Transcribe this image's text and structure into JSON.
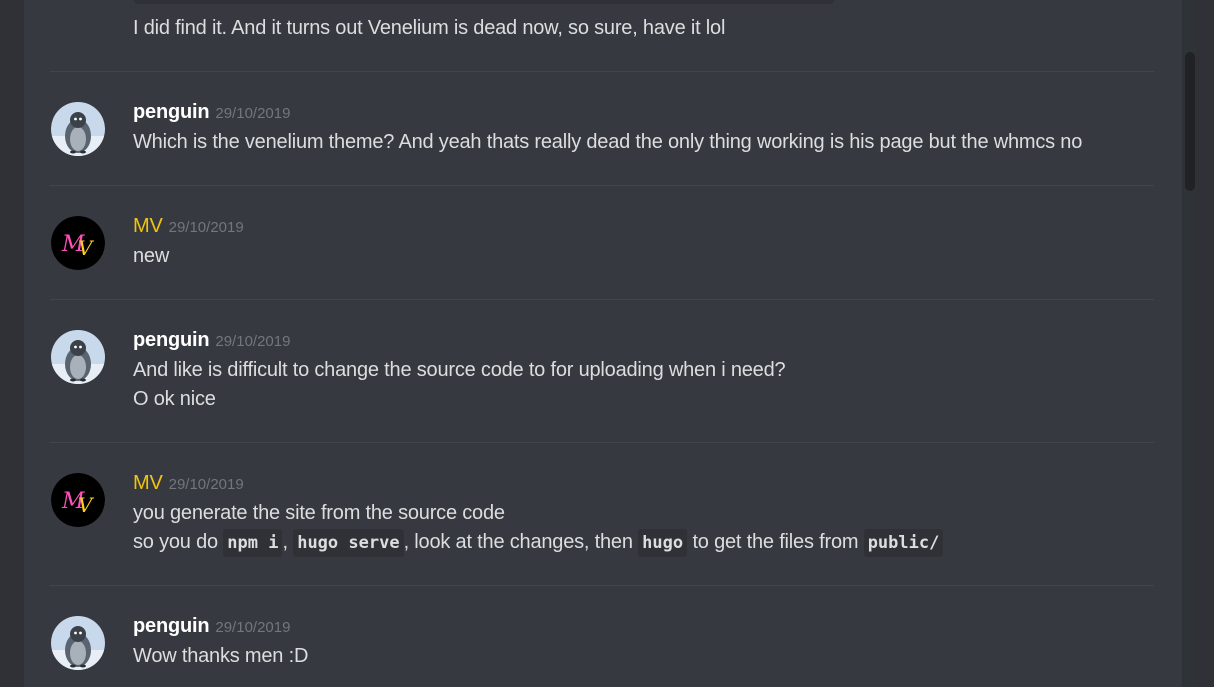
{
  "messages": [
    {
      "text": "I did find it. And it turns out Venelium is dead now, so sure, have it lol"
    },
    {
      "username": "penguin",
      "timestamp": "29/10/2019",
      "lines": [
        "Which is the venelium theme? And yeah thats really dead the only thing working is his page but the whmcs no"
      ]
    },
    {
      "username": "MV",
      "timestamp": "29/10/2019",
      "lines": [
        "new"
      ]
    },
    {
      "username": "penguin",
      "timestamp": "29/10/2019",
      "lines": [
        "And like is difficult to change the source code to for uploading when i need?",
        "O ok nice"
      ]
    },
    {
      "username": "MV",
      "timestamp": "29/10/2019",
      "lines": [
        "you generate the site from the source code"
      ],
      "inline": {
        "t1": "so you do ",
        "c1": "npm i",
        "t2": ", ",
        "c2": "hugo serve",
        "t3": ", look at the changes, then ",
        "c3": "hugo",
        "t4": " to get the files from ",
        "c4": "public/"
      }
    },
    {
      "username": "penguin",
      "timestamp": "29/10/2019",
      "lines": [
        "Wow thanks men :D"
      ]
    }
  ],
  "colors": {
    "background": "#36393f",
    "sidebar": "#2f3136",
    "username_default": "#ffffff",
    "username_mv": "#f1c40f",
    "timestamp": "#72767d",
    "text": "#dcddde"
  },
  "icons": {
    "penguin_avatar": "penguin-avatar-icon",
    "mv_avatar": "mv-avatar-icon"
  }
}
